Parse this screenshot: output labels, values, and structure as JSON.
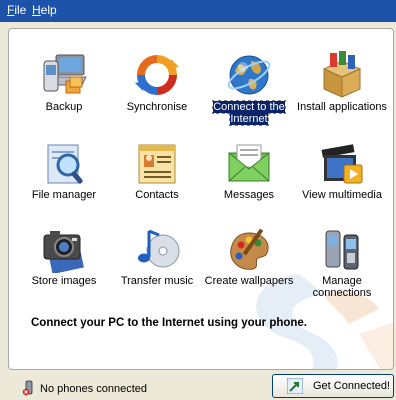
{
  "menu": {
    "file": {
      "accel": "F",
      "rest": "ile"
    },
    "help": {
      "accel": "H",
      "rest": "elp"
    }
  },
  "tiles": [
    {
      "label": "Backup",
      "icon": "backup-icon"
    },
    {
      "label": "Synchronise",
      "icon": "sync-icon"
    },
    {
      "label": "Connect to the Internet",
      "icon": "globe-icon",
      "selected": true
    },
    {
      "label": "Install applications",
      "icon": "install-icon"
    },
    {
      "label": "File manager",
      "icon": "file-manager-icon"
    },
    {
      "label": "Contacts",
      "icon": "contacts-icon"
    },
    {
      "label": "Messages",
      "icon": "messages-icon"
    },
    {
      "label": "View multimedia",
      "icon": "multimedia-icon"
    },
    {
      "label": "Store images",
      "icon": "camera-icon"
    },
    {
      "label": "Transfer music",
      "icon": "music-icon"
    },
    {
      "label": "Create wallpapers",
      "icon": "palette-icon"
    },
    {
      "label": "Manage connections",
      "icon": "phones-icon"
    }
  ],
  "status_message": "Connect your PC to the Internet using your phone.",
  "status": {
    "phones": "No phones connected",
    "connect_button": "Get Connected!"
  },
  "colors": {
    "menubar": "#1c52a8",
    "selection": "#0a246a",
    "window": "#ece9d8"
  }
}
